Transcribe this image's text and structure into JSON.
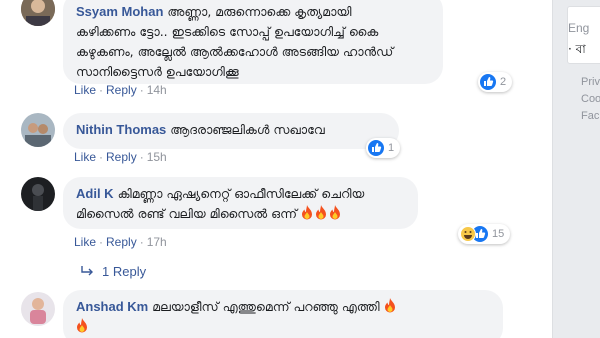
{
  "comments": [
    {
      "author": "Ssyam Mohan",
      "lines": [
        "അണ്ണാ, മരുന്നൊക്കെ കൃത്യമായി",
        "കഴിക്കണം ട്ടോ.. ഇടക്കിടെ സോപ്പ് ഉപയോഗിച്ച് കൈ",
        "കഴുകണം, അല്ലേൽ ആൽക്കഹോൾ അടങ്ങിയ ഹാൻഡ്",
        "സാനിട്ടൈസർ ഉപയോഗിക്കൂ"
      ],
      "like_label": "Like",
      "reply_label": "Reply",
      "time": "14h",
      "reaction_count": "2",
      "reaction_types": [
        "like"
      ]
    },
    {
      "author": "Nithin Thomas",
      "lines": [
        "ആദരാഞ്ജലികൾ സഖാവേ"
      ],
      "like_label": "Like",
      "reply_label": "Reply",
      "time": "15h",
      "reaction_count": "1",
      "reaction_types": [
        "like"
      ]
    },
    {
      "author": "Adil K",
      "lines": [
        "കിമണ്ണാ ഏഷ്യനെറ്റ് ഓഫീസിലേക്ക് ചെറിയ",
        "മിസൈൽ രണ്ട് വലിയ മിസൈൽ ഒന്ന്"
      ],
      "like_label": "Like",
      "reply_label": "Reply",
      "time": "17h",
      "reaction_count": "15",
      "reaction_types": [
        "haha",
        "like"
      ],
      "replies_label": "1 Reply"
    },
    {
      "author": "Anshad Km",
      "lines": [
        "മലയാളീസ് എത്തുമെന്ന് പറഞ്ഞു എത്തി"
      ]
    }
  ],
  "right_rail": {
    "card_text": "Eng",
    "card_sub": "· বা",
    "links": [
      "Priv",
      "Coo",
      "Fac"
    ]
  },
  "colors": {
    "link": "#385898",
    "bubble": "#f2f3f5",
    "like_blue": "#1877f2",
    "fire_orange": "#f4511e"
  }
}
